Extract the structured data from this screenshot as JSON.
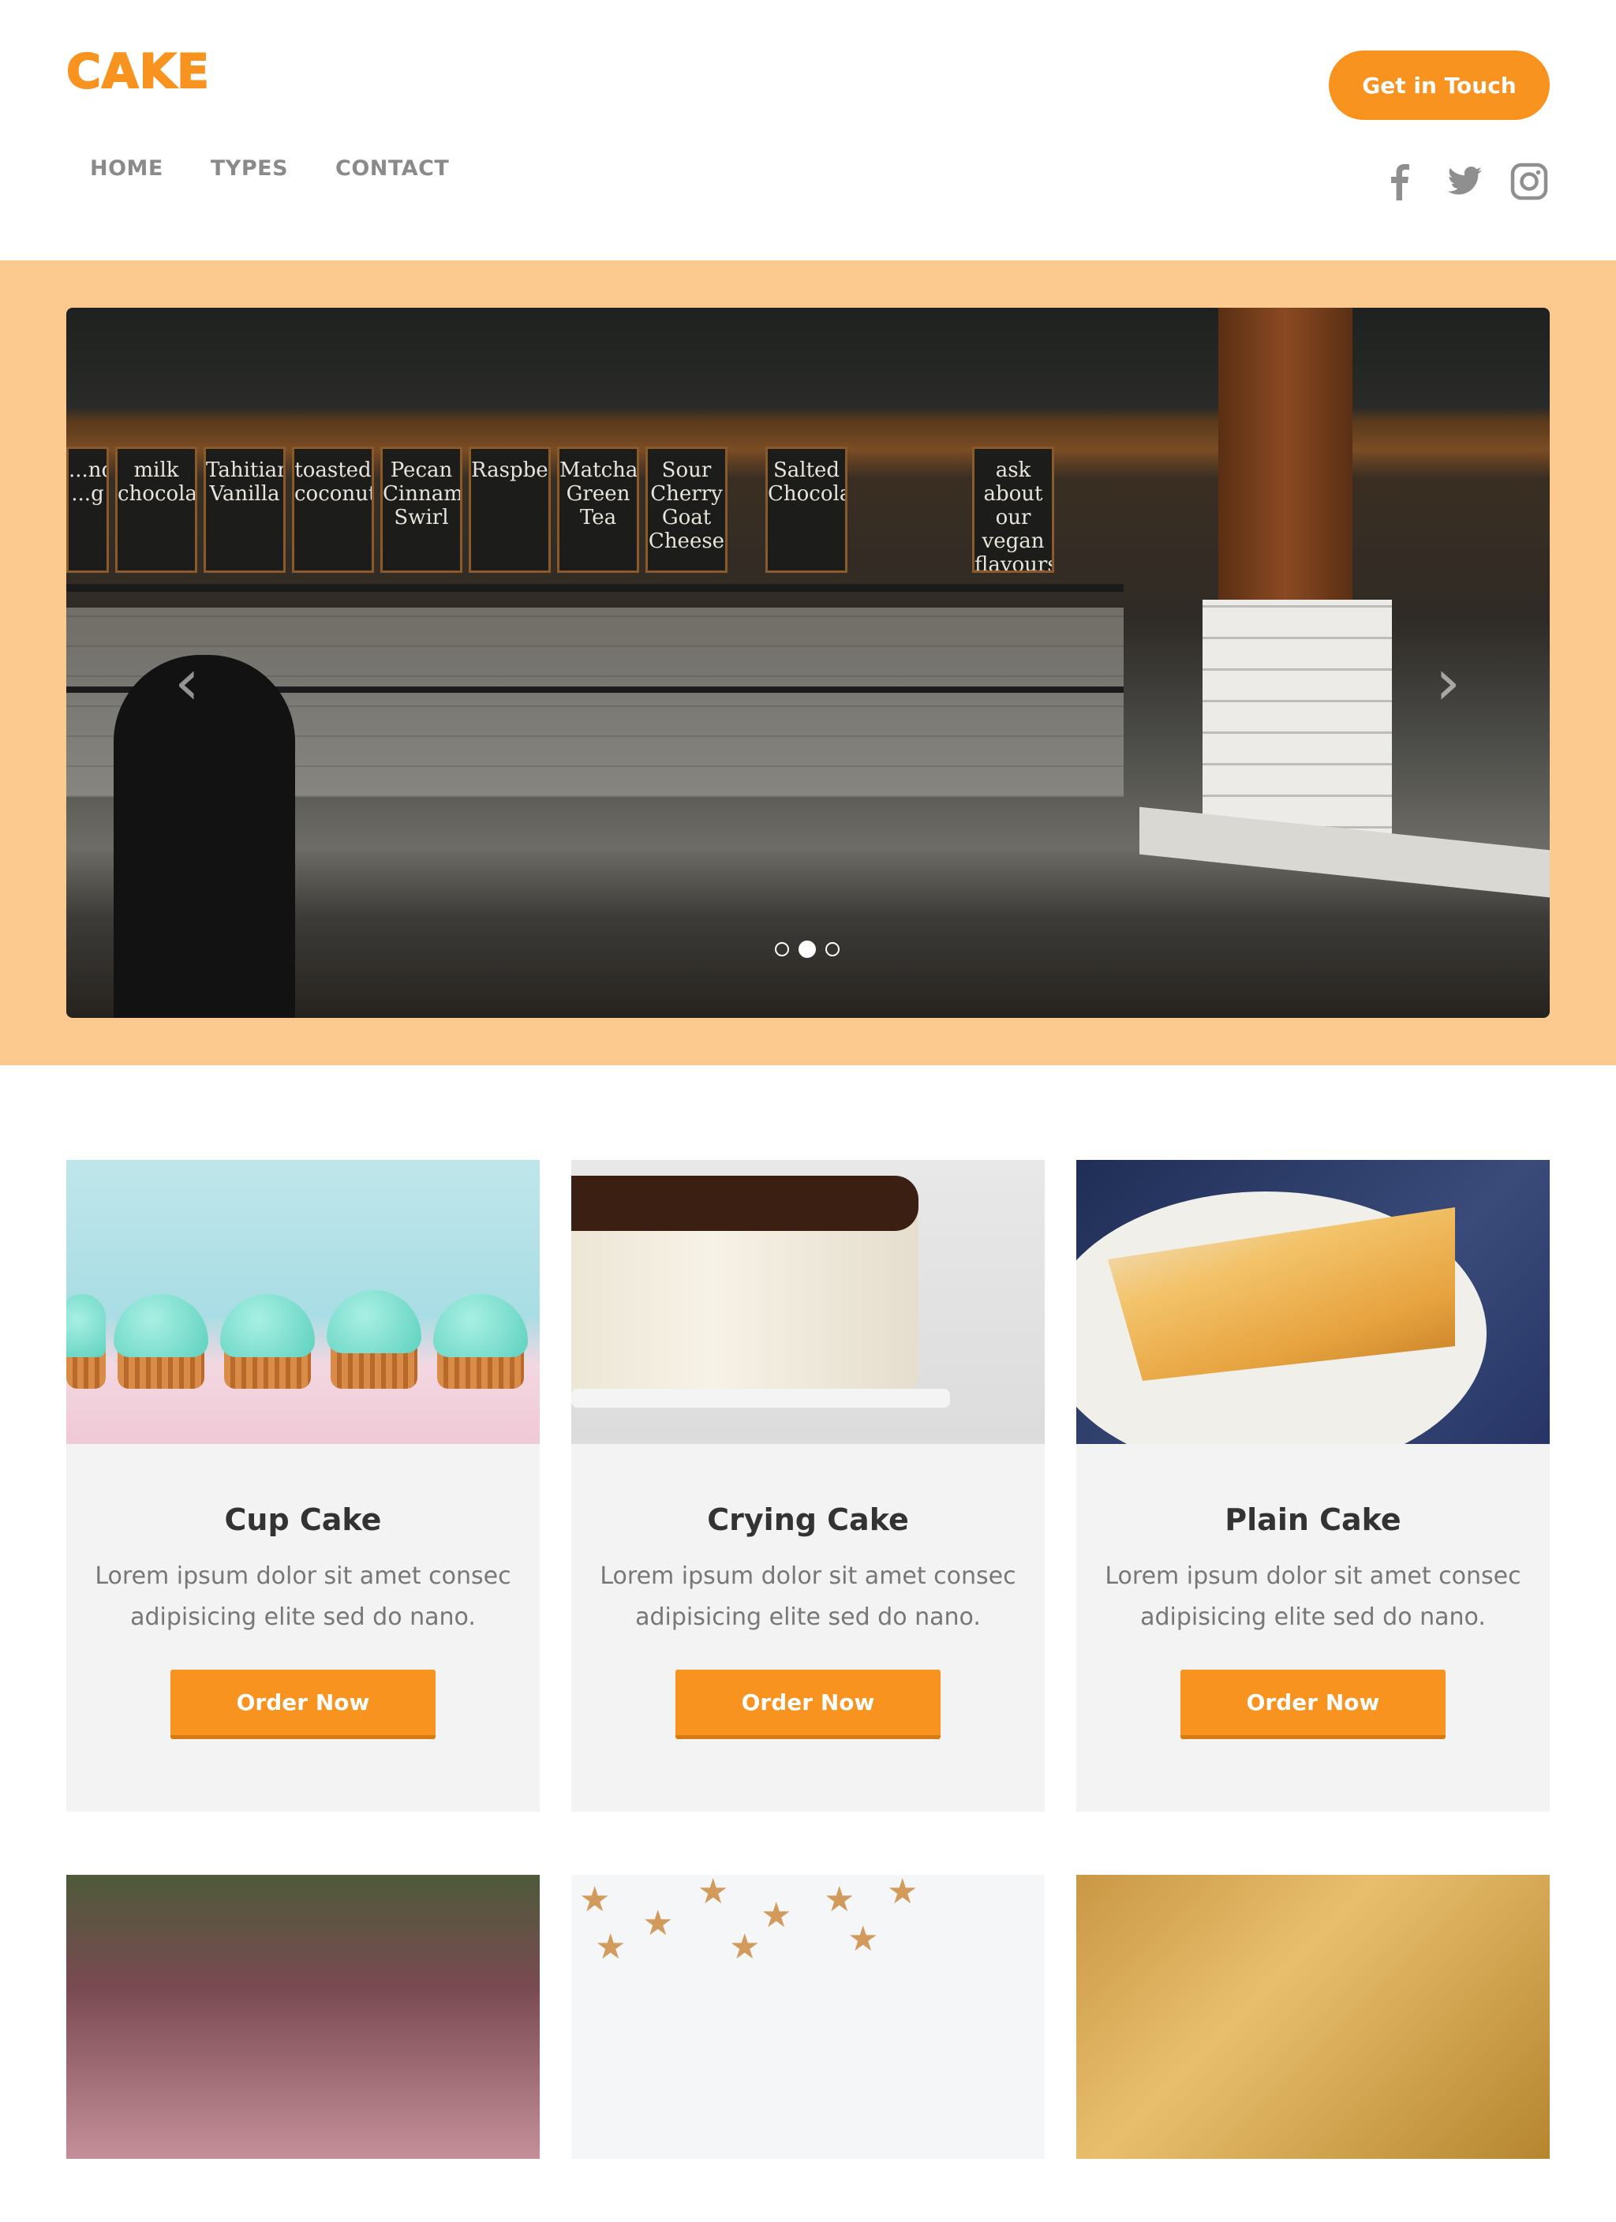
{
  "brand": {
    "logo": "CAKE",
    "accent_color": "#f7931e",
    "hero_bg_color": "#fcca8f"
  },
  "header": {
    "nav": [
      "HOME",
      "TYPES",
      "CONTACT"
    ],
    "cta_label": "Get in Touch",
    "social_icons": [
      "facebook-icon",
      "twitter-icon",
      "instagram-icon"
    ]
  },
  "slider": {
    "image": "bakery-counter-photo",
    "boards": [
      "...ndon ...g",
      "milk chocolate",
      "Tahitian Vanilla",
      "toasted coconut",
      "Pecan Cinnamon Swirl",
      "Raspberry",
      "Matcha Green Tea",
      "Sour Cherry Goat Cheese",
      "Salted Chocolate",
      "ask about our vegan flavours"
    ],
    "slides_total": 3,
    "active_slide": 2
  },
  "cards": [
    {
      "title": "Cup Cake",
      "text": "Lorem ipsum dolor sit amet consec adipisicing elite sed do nano.",
      "button": "Order Now",
      "image": "cupcakes"
    },
    {
      "title": "Crying Cake",
      "text": "Lorem ipsum dolor sit amet consec adipisicing elite sed do nano.",
      "button": "Order Now",
      "image": "chocolate-drip-cake"
    },
    {
      "title": "Plain Cake",
      "text": "Lorem ipsum dolor sit amet consec adipisicing elite sed do nano.",
      "button": "Order Now",
      "image": "sponge-cake-slices"
    }
  ],
  "cards_row2_images": [
    "happy-birthday-cake",
    "star-cookies",
    "glazed-pastries"
  ]
}
